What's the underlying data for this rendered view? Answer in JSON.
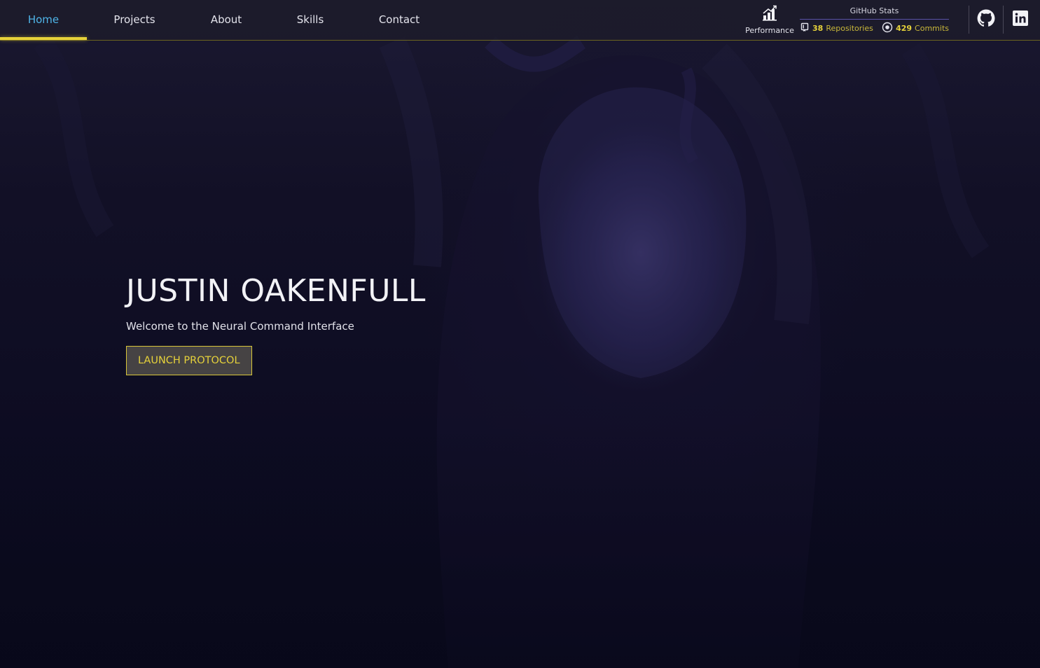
{
  "nav": {
    "items": [
      {
        "label": "Home",
        "active": true
      },
      {
        "label": "Projects",
        "active": false
      },
      {
        "label": "About",
        "active": false
      },
      {
        "label": "Skills",
        "active": false
      },
      {
        "label": "Contact",
        "active": false
      }
    ]
  },
  "performance": {
    "label": "Performance",
    "icon": "chart-bar-icon"
  },
  "github_stats": {
    "title": "GitHub Stats",
    "repositories": {
      "count": "38",
      "label": "Repositories",
      "icon": "repo-icon"
    },
    "commits": {
      "count": "429",
      "label": "Commits",
      "icon": "commit-icon"
    }
  },
  "social": [
    {
      "name": "github",
      "icon": "github-icon"
    },
    {
      "name": "linkedin",
      "icon": "linkedin-icon"
    }
  ],
  "hero": {
    "title": "JUSTIN OAKENFULL",
    "subtitle": "Welcome to the Neural Command Interface",
    "cta_label": "LAUNCH PROTOCOL"
  },
  "colors": {
    "accent_yellow": "#e6d23a",
    "active_blue": "#4fb5e8",
    "divider_purple": "#5a52a8",
    "background": "#0b0a1c"
  }
}
